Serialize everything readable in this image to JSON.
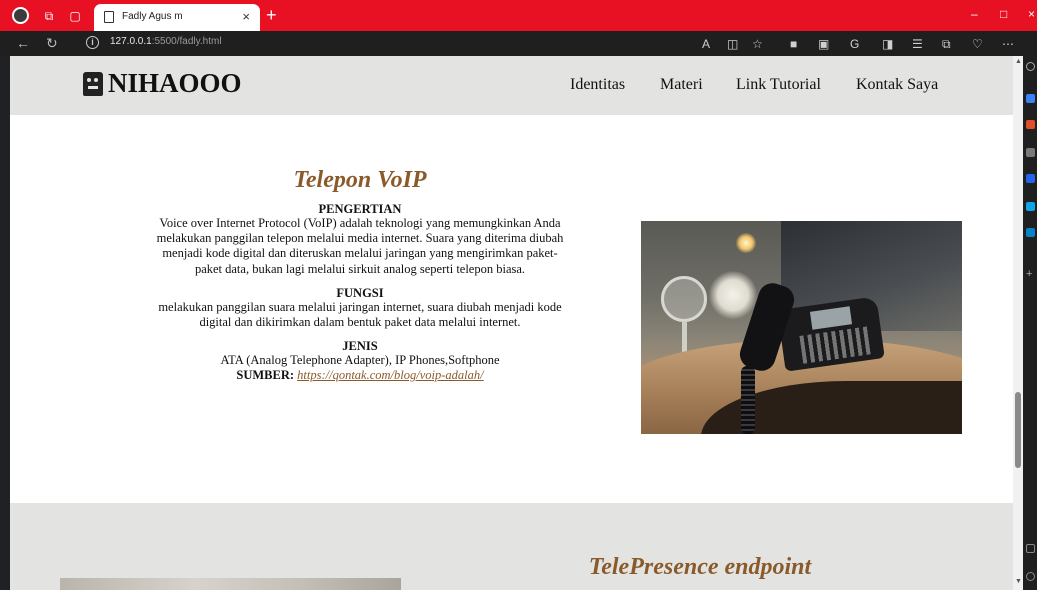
{
  "browser": {
    "tab_title": "Fadly Agus m",
    "tab_close": "×",
    "new_tab": "+",
    "url_host": "127.0.0.1",
    "url_rest": ":5500/fadly.html",
    "minimize": "–",
    "maximize": "□",
    "close": "×"
  },
  "header": {
    "logo_text": "NIHAOOO",
    "nav": [
      "Identitas",
      "Materi",
      "Link Tutorial",
      "Kontak Saya"
    ]
  },
  "section1": {
    "title": "Telepon VoIP",
    "pengertian_head": "PENGERTIAN",
    "pengertian_text": "Voice over Internet Protocol (VoIP) adalah teknologi yang memungkinkan Anda melakukan panggilan telepon melalui media internet. Suara yang diterima diubah menjadi kode digital dan diteruskan melalui jaringan yang mengirimkan paket-paket data, bukan lagi melalui sirkuit analog seperti telepon biasa.",
    "fungsi_head": "FUNGSI",
    "fungsi_text": "melakukan panggilan suara melalui jaringan internet, suara diubah menjadi kode digital dan dikirimkan dalam bentuk paket data melalui internet.",
    "jenis_head": "JENIS",
    "jenis_text": "ATA (Analog Telephone Adapter), IP Phones,Softphone",
    "sumber_label": "SUMBER:",
    "sumber_link": "https://qontak.com/blog/voip-adalah/"
  },
  "section2": {
    "title": "TelePresence endpoint"
  },
  "colors": {
    "titlebar": "#e81123",
    "accent_brown": "#8b5a2b",
    "header_bg": "#e3e4e2"
  }
}
